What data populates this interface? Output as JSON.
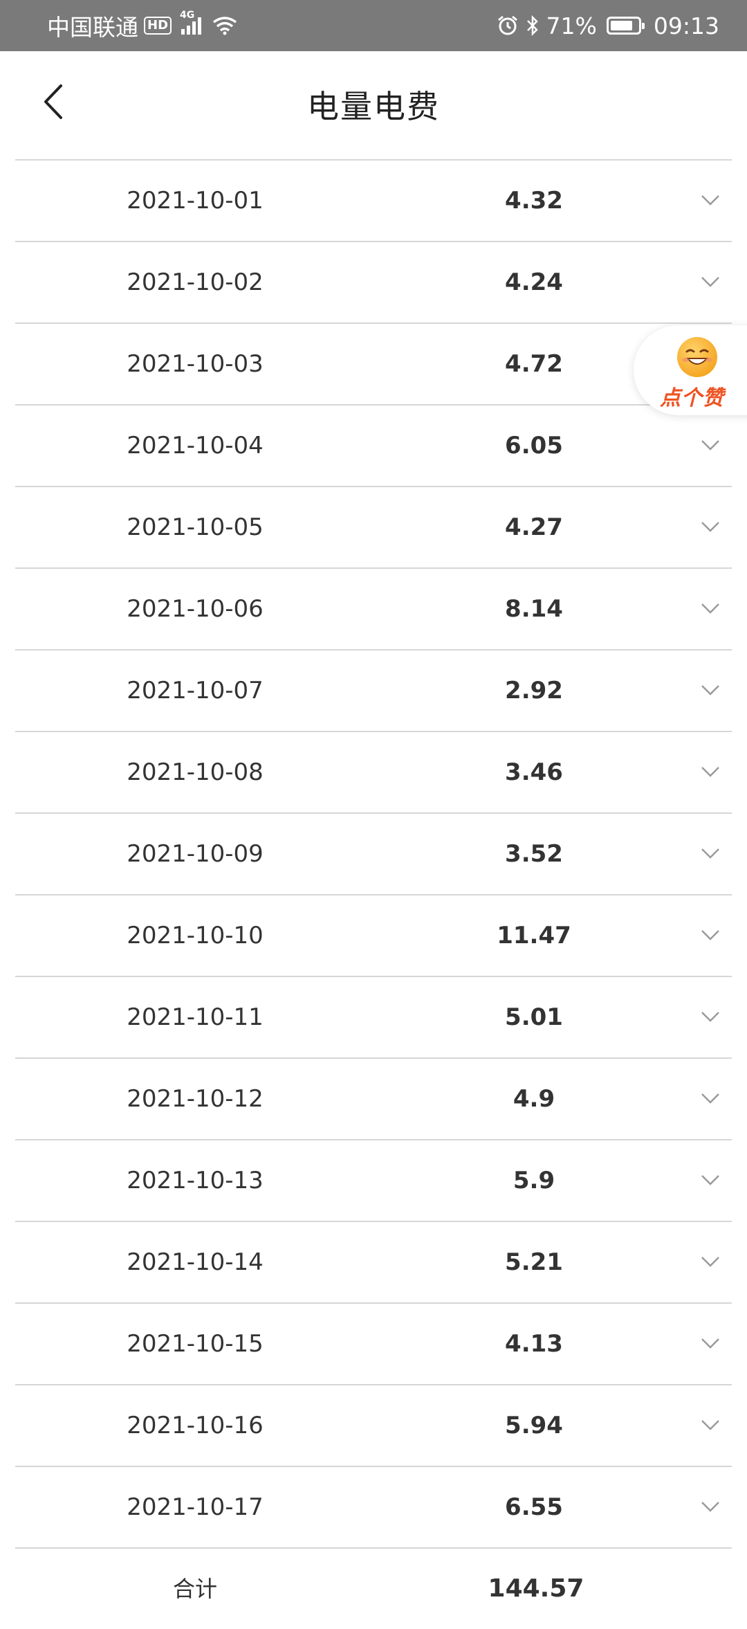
{
  "status_bar": {
    "carrier": "中国联通",
    "hd": "HD",
    "network": "4G",
    "battery": "71%",
    "time": "09:13"
  },
  "header": {
    "title": "电量电费"
  },
  "rows": [
    {
      "date": "2021-10-01",
      "value": "4.32"
    },
    {
      "date": "2021-10-02",
      "value": "4.24"
    },
    {
      "date": "2021-10-03",
      "value": "4.72"
    },
    {
      "date": "2021-10-04",
      "value": "6.05"
    },
    {
      "date": "2021-10-05",
      "value": "4.27"
    },
    {
      "date": "2021-10-06",
      "value": "8.14"
    },
    {
      "date": "2021-10-07",
      "value": "2.92"
    },
    {
      "date": "2021-10-08",
      "value": "3.46"
    },
    {
      "date": "2021-10-09",
      "value": "3.52"
    },
    {
      "date": "2021-10-10",
      "value": "11.47"
    },
    {
      "date": "2021-10-11",
      "value": "5.01"
    },
    {
      "date": "2021-10-12",
      "value": "4.9"
    },
    {
      "date": "2021-10-13",
      "value": "5.9"
    },
    {
      "date": "2021-10-14",
      "value": "5.21"
    },
    {
      "date": "2021-10-15",
      "value": "4.13"
    },
    {
      "date": "2021-10-16",
      "value": "5.94"
    },
    {
      "date": "2021-10-17",
      "value": "6.55"
    }
  ],
  "total": {
    "label": "合计",
    "value": "144.57"
  },
  "like_button": {
    "label": "点个赞"
  },
  "icons": {
    "back": "chevron-left-icon",
    "expand": "chevron-down-icon",
    "like": "smiley-face-icon"
  },
  "colors": {
    "status_bar_bg": "#7a7a7a",
    "divider": "#d6d6d6",
    "like_text": "#ef5322",
    "smiley": "#f7b731"
  }
}
